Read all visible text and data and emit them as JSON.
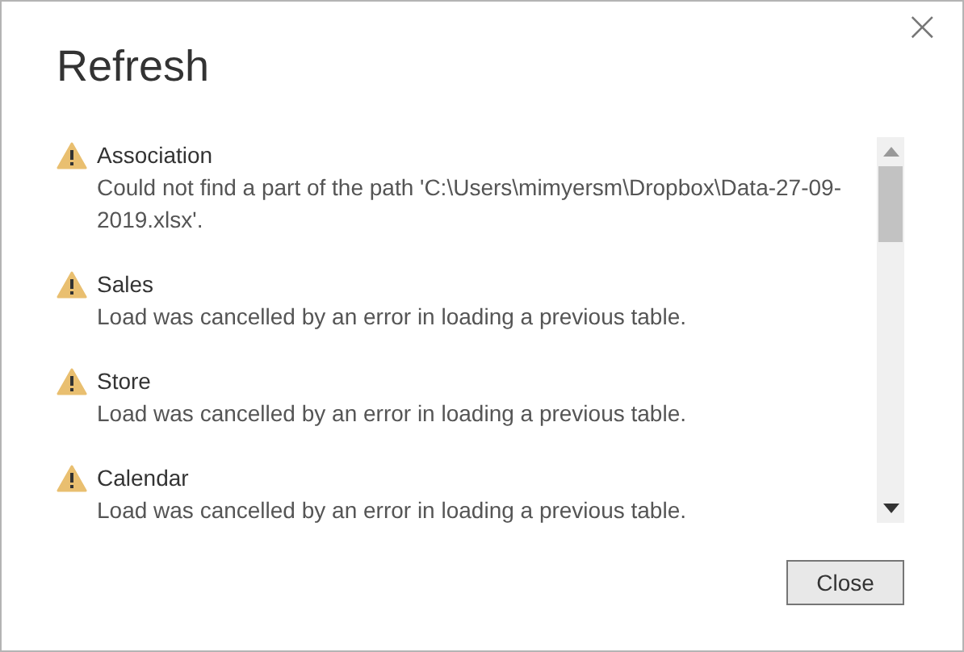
{
  "dialog": {
    "title": "Refresh",
    "close_icon": "×"
  },
  "errors": [
    {
      "name": "Association",
      "message": "Could not find a part of the path 'C:\\Users\\mimyersm\\Dropbox\\Data-27-09-2019.xlsx'."
    },
    {
      "name": "Sales",
      "message": "Load was cancelled by an error in loading a previous table."
    },
    {
      "name": "Store",
      "message": "Load was cancelled by an error in loading a previous table."
    },
    {
      "name": "Calendar",
      "message": "Load was cancelled by an error in loading a previous table."
    }
  ],
  "buttons": [
    "Close"
  ]
}
